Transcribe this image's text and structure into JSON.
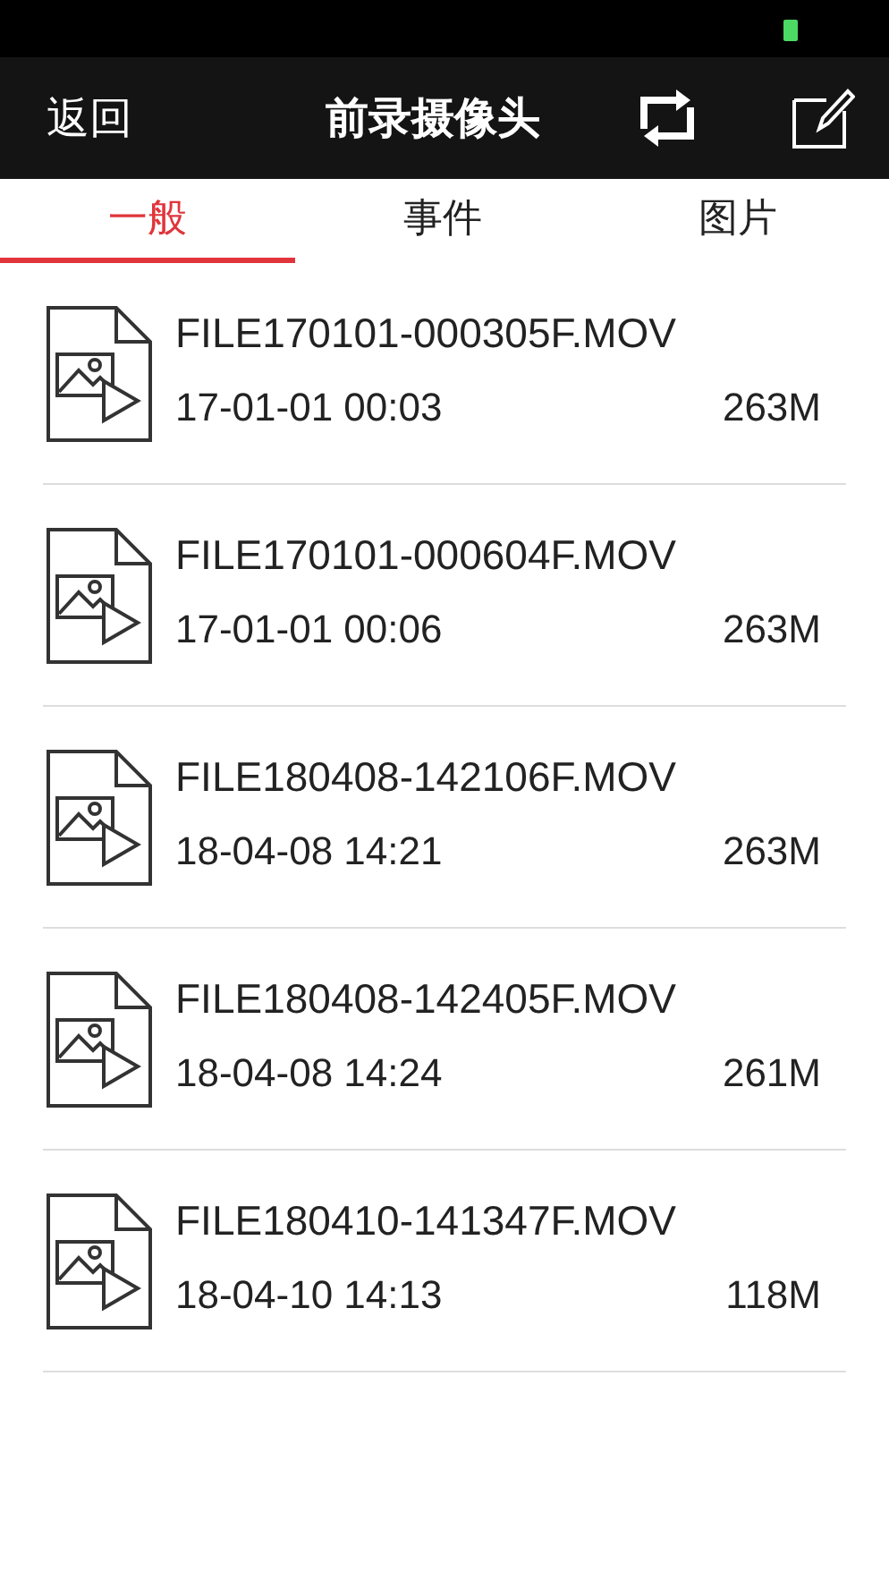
{
  "nav": {
    "back": "返回",
    "title": "前录摄像头"
  },
  "tabs": [
    {
      "label": "一般",
      "selected": true
    },
    {
      "label": "事件",
      "selected": false
    },
    {
      "label": "图片",
      "selected": false
    }
  ],
  "files": [
    {
      "name": "FILE170101-000305F.MOV",
      "date": "17-01-01 00:03",
      "size": "263M"
    },
    {
      "name": "FILE170101-000604F.MOV",
      "date": "17-01-01 00:06",
      "size": "263M"
    },
    {
      "name": "FILE180408-142106F.MOV",
      "date": "18-04-08 14:21",
      "size": "263M"
    },
    {
      "name": "FILE180408-142405F.MOV",
      "date": "18-04-08 14:24",
      "size": "261M"
    },
    {
      "name": "FILE180410-141347F.MOV",
      "date": "18-04-10 14:13",
      "size": "118M"
    }
  ]
}
